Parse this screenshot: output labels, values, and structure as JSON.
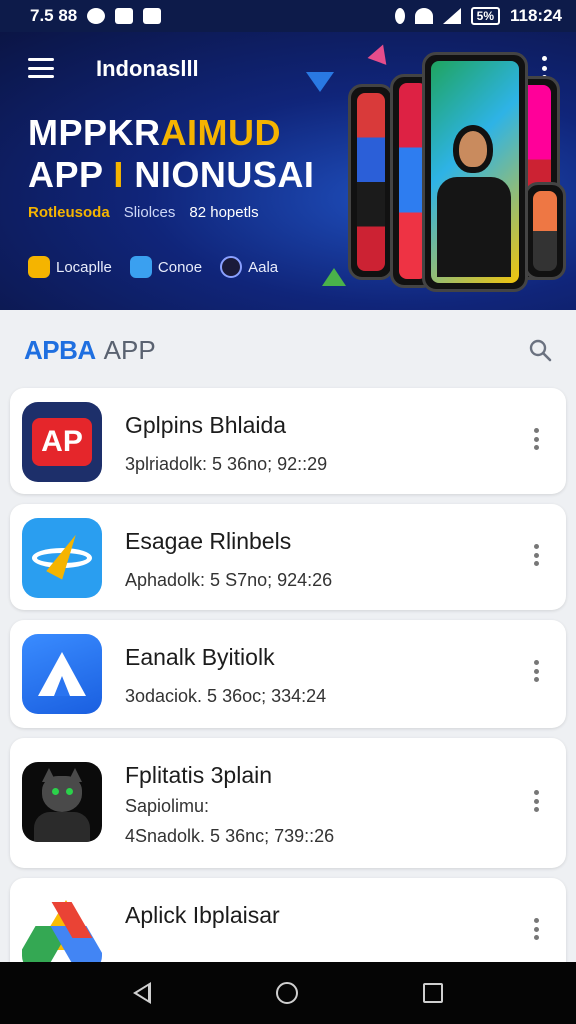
{
  "status_bar": {
    "time_left": "7.5 88",
    "battery": "5%",
    "time_right": "118:24"
  },
  "banner": {
    "title": "Indonaslll",
    "headline_line1_a": "MPPKR",
    "headline_line1_b": "AIMUD",
    "headline_line2_a": "APP ",
    "headline_line2_b": "I",
    "headline_line2_c": " NIONUSAI",
    "tagline": [
      "Rotleusoda",
      "Sliolces",
      "82 hopetls"
    ],
    "chips": [
      {
        "label": "Locaplle",
        "icon": "smile-icon"
      },
      {
        "label": "Conoe",
        "icon": "photo-icon"
      },
      {
        "label": "Aala",
        "icon": "compass-icon"
      }
    ]
  },
  "appbar": {
    "brand": "APBA",
    "brand_sub": "APP"
  },
  "apps": [
    {
      "name": "Gplpins Bhlaida",
      "meta": "3plriadolk: 5 36no; 92::29",
      "icon": "ap-logo-icon"
    },
    {
      "name": "Esagae Rlinbels",
      "meta": "Aphadolk: 5 S7no; 924:26",
      "icon": "ring-bolt-icon"
    },
    {
      "name": "Eanalk Byitiolk",
      "meta": "3odaciok. 5 36oc; 334:24",
      "icon": "a-logo-icon"
    },
    {
      "name": "Fplitatis 3plain",
      "sub": "Sapiolimu:",
      "meta": "4Snadolk. 5 36nc; 739::26",
      "icon": "cat-avatar-icon"
    },
    {
      "name": "Aplick Ibplaisar",
      "meta": "",
      "icon": "drive-logo-icon"
    }
  ],
  "colors": {
    "brand_blue": "#1f6fe0",
    "banner_dark": "#0b1545",
    "accent_yellow": "#f5b400"
  }
}
